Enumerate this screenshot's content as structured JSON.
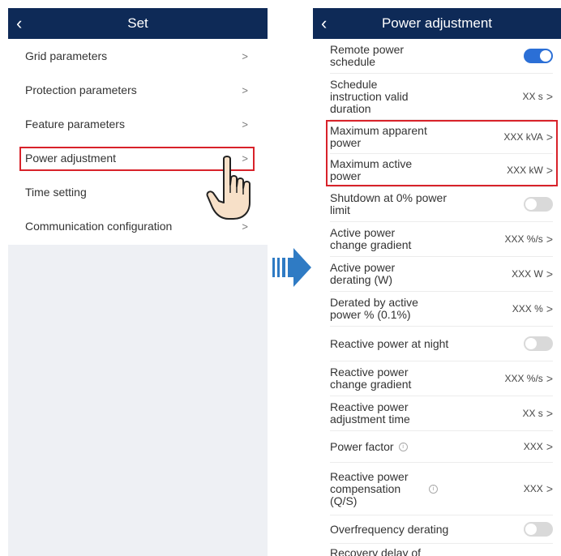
{
  "left_screen": {
    "header": {
      "back_icon": "chevron-left-icon",
      "title": "Set"
    },
    "items": [
      {
        "label": "Grid parameters"
      },
      {
        "label": "Protection parameters"
      },
      {
        "label": "Feature parameters"
      },
      {
        "label": "Power adjustment",
        "highlighted": true
      },
      {
        "label": "Time setting"
      },
      {
        "label": "Communication configuration"
      }
    ],
    "chevron": ">"
  },
  "transition_arrow": "right-arrow-icon",
  "right_screen": {
    "header": {
      "back_icon": "chevron-left-icon",
      "title": "Power adjustment"
    },
    "rows": [
      {
        "label": "Remote power schedule",
        "toggle": "on"
      },
      {
        "label": "Schedule instruction valid duration",
        "value": "XX s"
      },
      {
        "label": "Maximum apparent power",
        "value": "XXX kVA",
        "highlighted": true
      },
      {
        "label": "Maximum active power",
        "value": "XXX kW",
        "highlighted": true
      },
      {
        "label": "Shutdown at 0% power limit",
        "toggle": "off"
      },
      {
        "label": "Active power change gradient",
        "value": "XXX %/s"
      },
      {
        "label": "Active power derating (W)",
        "value": "XXX W"
      },
      {
        "label": "Derated by active power % (0.1%)",
        "value": "XXX %"
      },
      {
        "label": "Reactive power at night",
        "toggle": "off"
      },
      {
        "label": "Reactive power change gradient",
        "value": "XXX %/s"
      },
      {
        "label": "Reactive power adjustment time",
        "value": "XX s"
      },
      {
        "label": "Power factor",
        "value": "XXX",
        "info": true
      },
      {
        "label": "Reactive power compensation (Q/S)",
        "value": "XXX",
        "info": true
      },
      {
        "label": "Overfrequency derating",
        "toggle": "off"
      },
      {
        "label": "Recovery delay of"
      }
    ],
    "chevron": ">",
    "info_glyph": "i"
  },
  "colors": {
    "header_bg": "#0e2a57",
    "highlight": "#d8222a",
    "toggle_on": "#2b6fd6",
    "arrow": "#2f7bc4"
  }
}
